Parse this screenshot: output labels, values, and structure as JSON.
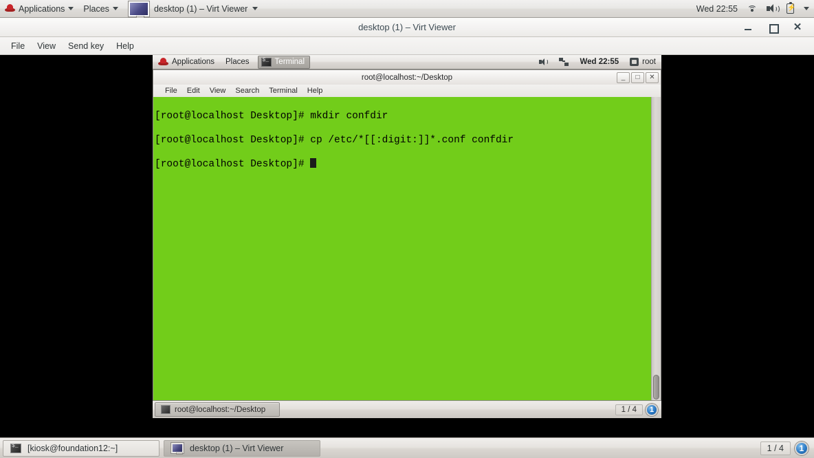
{
  "host_panel": {
    "applications_label": "Applications",
    "places_label": "Places",
    "window_button_label": "desktop (1) – Virt Viewer",
    "clock": "Wed 22:55",
    "icons": [
      "redhat-icon",
      "chevron-down-icon",
      "wifi-icon",
      "volume-icon",
      "battery-icon",
      "chevron-down-icon"
    ]
  },
  "virt_viewer": {
    "title": "desktop (1) – Virt Viewer",
    "menu": [
      {
        "label": "File"
      },
      {
        "label": "View"
      },
      {
        "label": "Send key"
      },
      {
        "label": "Help"
      }
    ],
    "controls": {
      "minimize": "−",
      "maximize": "□",
      "close": "✕"
    }
  },
  "guest": {
    "top_panel": {
      "applications_label": "Applications",
      "places_label": "Places",
      "window_button_label": "Terminal",
      "clock": "Wed 22:55",
      "user": "root"
    },
    "terminal": {
      "title": "root@localhost:~/Desktop",
      "menu": [
        {
          "label": "File"
        },
        {
          "label": "Edit"
        },
        {
          "label": "View"
        },
        {
          "label": "Search"
        },
        {
          "label": "Terminal"
        },
        {
          "label": "Help"
        }
      ],
      "controls": {
        "minimize": "_",
        "maximize": "□",
        "close": "✕"
      },
      "background_color": "#72cd1a",
      "foreground_color": "#000000",
      "lines": [
        "[root@localhost Desktop]# mkdir confdir",
        "[root@localhost Desktop]# cp /etc/*[[:digit:]]*.conf confdir"
      ],
      "prompt": "[root@localhost Desktop]# "
    },
    "bottom_panel": {
      "window_button_label": "root@localhost:~/Desktop",
      "workspace_count": "1 / 4",
      "workspace_badge": "1"
    }
  },
  "host_taskbar": {
    "buttons": [
      {
        "label": "[kiosk@foundation12:~]",
        "icon": "terminal-icon",
        "active": false
      },
      {
        "label": "desktop (1) – Virt Viewer",
        "icon": "monitor-icon",
        "active": true
      }
    ],
    "workspace_count": "1 / 4",
    "workspace_badge": "1"
  }
}
